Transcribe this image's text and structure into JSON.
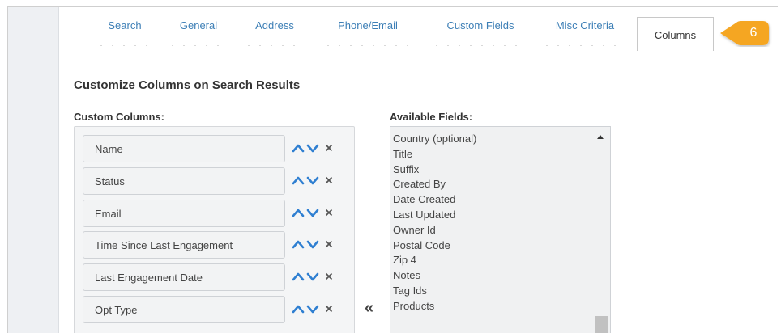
{
  "tabs": [
    {
      "label": "Search"
    },
    {
      "label": "General"
    },
    {
      "label": "Address"
    },
    {
      "label": "Phone/Email"
    },
    {
      "label": "Custom Fields"
    },
    {
      "label": "Misc Criteria"
    }
  ],
  "active_tab": {
    "label": "Columns"
  },
  "badge": {
    "label": "6",
    "color": "#f5a623"
  },
  "section_title": "Customize Columns on Search Results",
  "custom_columns": {
    "label": "Custom Columns:",
    "items": [
      {
        "label": "Name"
      },
      {
        "label": "Status"
      },
      {
        "label": "Email"
      },
      {
        "label": "Time Since Last Engagement"
      },
      {
        "label": "Last Engagement Date"
      },
      {
        "label": "Opt Type"
      }
    ]
  },
  "move_left_glyph": "«",
  "available_fields": {
    "label": "Available Fields:",
    "items": [
      "Country (optional)",
      "Title",
      "Suffix",
      "Created By",
      "Date Created",
      "Last Updated",
      "Owner Id",
      "Postal Code",
      "Zip 4",
      "Notes",
      "Tag Ids",
      "Products"
    ]
  },
  "colors": {
    "link": "#3d7fb6",
    "arrow": "#2f7fd1",
    "remove": "#555555"
  },
  "icons": {
    "up": "chevron-up-icon",
    "down": "chevron-down-icon",
    "remove": "close-icon"
  }
}
